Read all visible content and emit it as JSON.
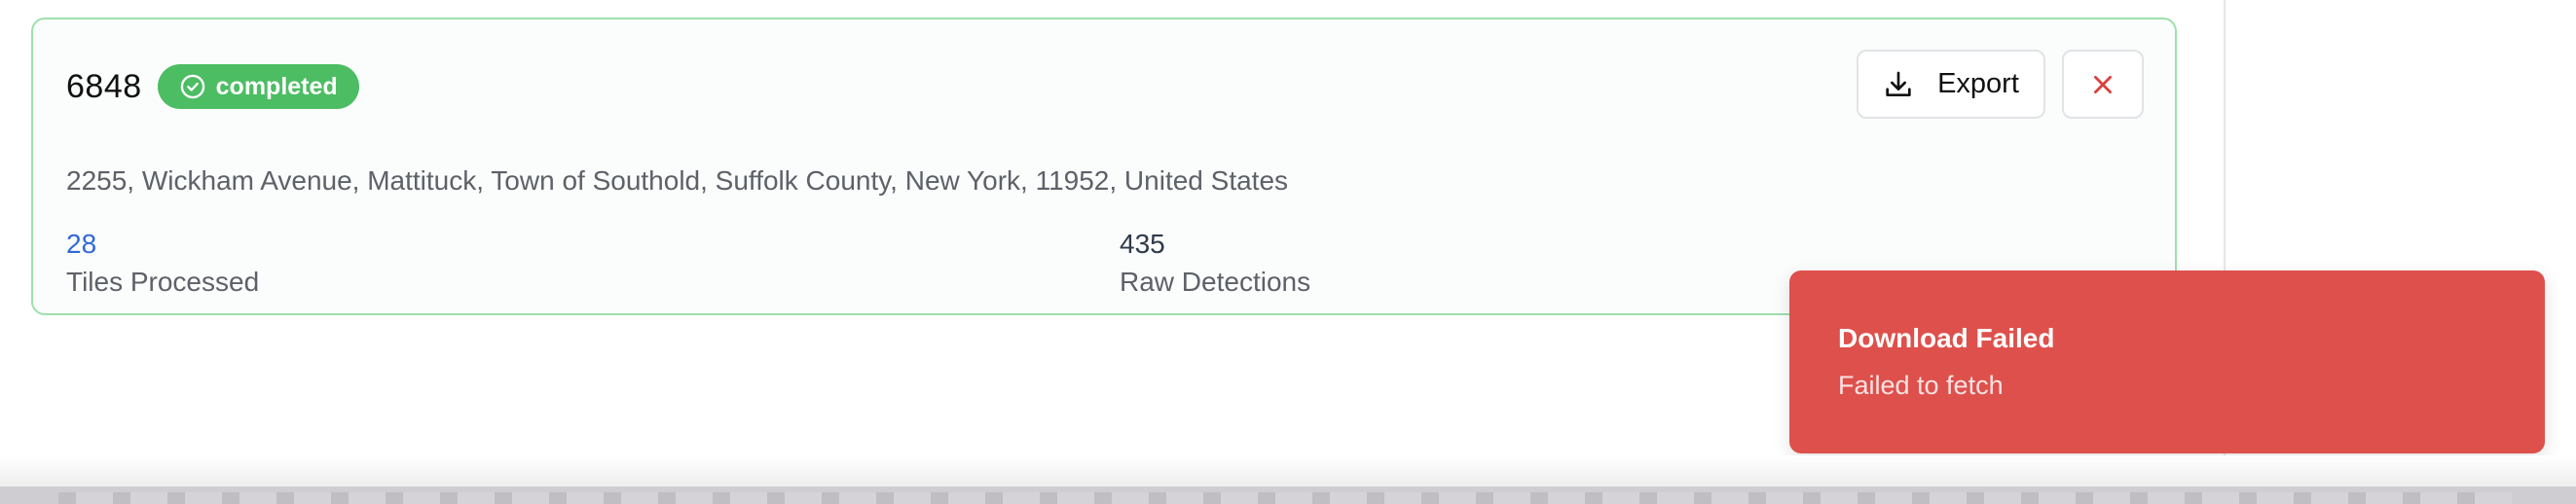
{
  "job": {
    "id": "6848",
    "status": "completed",
    "address": "2255, Wickham Avenue, Mattituck, Town of Southold, Suffolk County, New York, 11952, United States",
    "stats": [
      {
        "value": "28",
        "label": "Tiles Processed"
      },
      {
        "value": "435",
        "label": "Raw Detections"
      }
    ]
  },
  "actions": {
    "export_label": "Export",
    "close_icon": "close-icon",
    "export_icon": "download-icon"
  },
  "toast": {
    "title": "Download Failed",
    "message": "Failed to fetch"
  },
  "colors": {
    "status_green": "#4dbd63",
    "card_border": "#9ee0ac",
    "toast_red": "#de504c",
    "link_blue": "#2f6ad6",
    "close_red": "#d9413d"
  }
}
